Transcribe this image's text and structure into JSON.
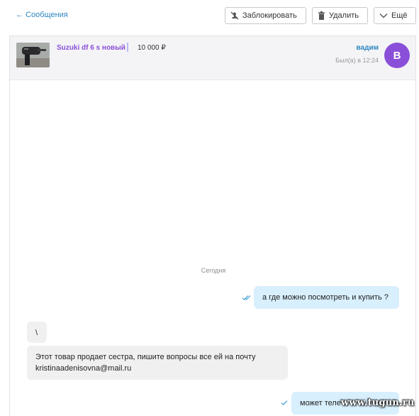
{
  "topbar": {
    "back_label": "← Сообщения",
    "block_label": "Заблокировать",
    "delete_label": "Удалить",
    "more_label": "Ещё"
  },
  "header": {
    "item_title": "Suzuki df 6 s новый",
    "item_price": "10 000 ₽",
    "user_name": "вадим",
    "last_seen": "Был(а) в 12:24",
    "avatar_letter": "В",
    "avatar_color": "#8a4fd8"
  },
  "chat": {
    "date_separator": "Сегодня",
    "messages": [
      {
        "direction": "out",
        "text": "а где можно посмотреть и купить ?",
        "status": "read"
      },
      {
        "direction": "in",
        "text": "\\"
      },
      {
        "direction": "in",
        "text": "Этот товар продает сестра, пишите вопросы все ей на почту kristinaadenisovna@mail.ru"
      },
      {
        "direction": "out",
        "text": "может теле",
        "status": "sent"
      }
    ]
  },
  "watermark": "www.tugun.ru",
  "colors": {
    "link": "#2e86c1",
    "accent": "#8a4fd8",
    "outgoing_bubble": "#d8effd",
    "incoming_bubble": "#f0f0f0"
  }
}
